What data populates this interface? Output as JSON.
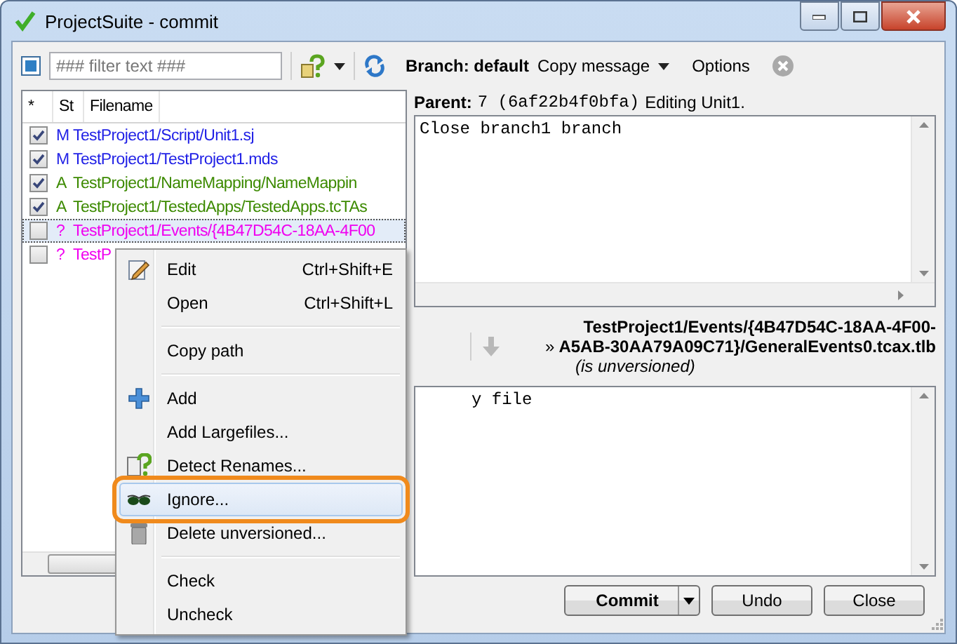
{
  "window": {
    "title": "ProjectSuite - commit"
  },
  "toolbar": {
    "filter": {
      "placeholder": "### filter text ###"
    },
    "branch": "Branch: default",
    "menus": [
      "Copy message",
      "Options"
    ]
  },
  "file_list": {
    "columns": [
      "*",
      "St",
      "Filename"
    ],
    "rows": [
      {
        "checked": true,
        "status": "M",
        "filename": "TestProject1/Script/Unit1.sj",
        "color": "#1f1fe6",
        "selected": false
      },
      {
        "checked": true,
        "status": "M",
        "filename": "TestProject1/TestProject1.mds",
        "color": "#1f1fe6",
        "selected": false
      },
      {
        "checked": true,
        "status": "A",
        "filename": "TestProject1/NameMapping/NameMappin",
        "color": "#3c8a00",
        "selected": false
      },
      {
        "checked": true,
        "status": "A",
        "filename": "TestProject1/TestedApps/TestedApps.tcTAs",
        "color": "#3c8a00",
        "selected": false
      },
      {
        "checked": false,
        "status": "?",
        "filename": "TestProject1/Events/{4B47D54C-18AA-4F00",
        "color": "#f000f0",
        "selected": true
      },
      {
        "checked": false,
        "status": "?",
        "filename": "TestP",
        "color": "#f000f0",
        "selected": false
      }
    ]
  },
  "commit": {
    "parent_label": "Parent:",
    "parent_rev": "7 (6af22b4f0bfa)",
    "parent_desc": "Editing Unit1.",
    "message": "Close branch1 branch"
  },
  "diff": {
    "path_line1": "TestProject1/Events/{4B47D54C-18AA-4F00-",
    "marker": "»",
    "path_line2": "A5AB-30AA79A09C71}/GeneralEvents0.tcax.tlb",
    "note": "(is unversioned)",
    "content": "y file"
  },
  "buttons": [
    {
      "label": "Commit",
      "kind": "split"
    },
    {
      "label": "Undo",
      "kind": "plain"
    },
    {
      "label": "Close",
      "kind": "plain"
    }
  ],
  "context_menu": {
    "items": [
      {
        "kind": "item",
        "label": "Edit",
        "shortcut": "Ctrl+Shift+E",
        "selected": false
      },
      {
        "kind": "item",
        "label": "Open",
        "shortcut": "Ctrl+Shift+L",
        "selected": false
      },
      {
        "kind": "separator"
      },
      {
        "kind": "item",
        "label": "Copy path",
        "selected": false
      },
      {
        "kind": "separator"
      },
      {
        "kind": "item",
        "label": "Add",
        "selected": false
      },
      {
        "kind": "item",
        "label": "Add Largefiles...",
        "selected": false
      },
      {
        "kind": "item",
        "label": "Detect Renames...",
        "selected": false
      },
      {
        "kind": "item",
        "label": "Ignore...",
        "selected": true
      },
      {
        "kind": "item",
        "label": "Delete unversioned...",
        "selected": false
      },
      {
        "kind": "separator"
      },
      {
        "kind": "item",
        "label": "Check",
        "selected": false
      },
      {
        "kind": "item",
        "label": "Uncheck",
        "selected": false
      }
    ]
  }
}
